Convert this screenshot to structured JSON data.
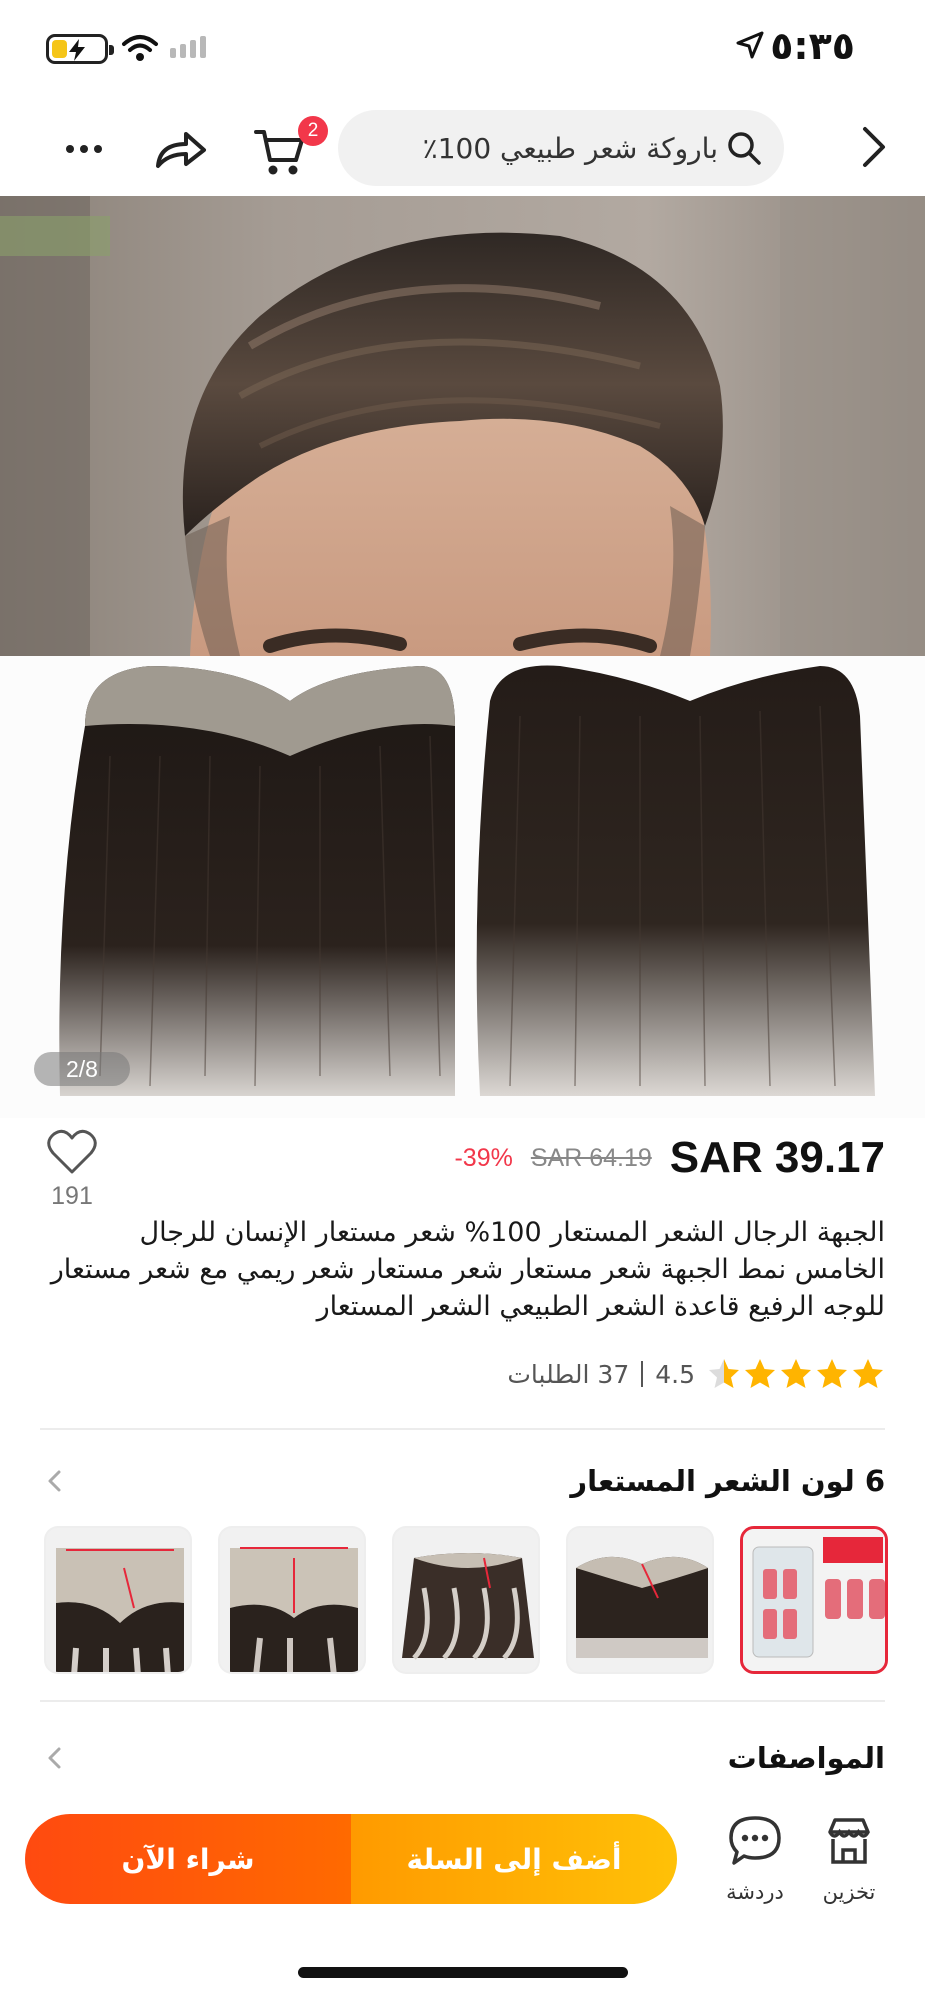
{
  "status_bar": {
    "time": "٥:٣٥",
    "battery_level": 0.3,
    "icons": [
      "location-arrow-icon",
      "wifi-icon",
      "cellular-signal-icon",
      "battery-charging-icon"
    ]
  },
  "header": {
    "search_placeholder": "باروكة شعر طبيعي 100٪",
    "cart_count": "2",
    "icons": [
      "chevron-back-icon",
      "search-icon",
      "cart-icon",
      "share-icon",
      "more-icon"
    ]
  },
  "gallery": {
    "page_indicator": "2/8",
    "current": 2,
    "total": 8
  },
  "price": {
    "current": "SAR 39.17",
    "original": "SAR 64.19",
    "discount": "-39%"
  },
  "wishlist": {
    "count": "191"
  },
  "product": {
    "title": "الجبهة الرجال الشعر المستعار 100% شعر مستعار الإنسان للرجال الخامس نمط الجبهة شعر مستعار شعر مستعار شعر ريمي مع شعر مستعار للوجه الرفيع قاعدة الشعر الطبيعي الشعر المستعار",
    "rating": "4.5",
    "rating_value": 4.5,
    "orders_count": "37",
    "orders_label": "الطلبات"
  },
  "variants": {
    "title": "6 لون الشعر المستعار",
    "items": [
      "accessory-tape",
      "hairpiece-straight",
      "hairpiece-wavy",
      "hairpiece-v-front",
      "hairpiece-v-wide"
    ]
  },
  "specs": {
    "title": "المواصفات"
  },
  "bottom_bar": {
    "store_label": "تخزين",
    "chat_label": "دردشة",
    "add_to_cart": "أضف إلى السلة",
    "buy_now": "شراء الآن"
  },
  "colors": {
    "accent_red": "#f2374a",
    "add_cart_yellow": "#ffb300",
    "buy_now_orange": "#ff4a10"
  }
}
